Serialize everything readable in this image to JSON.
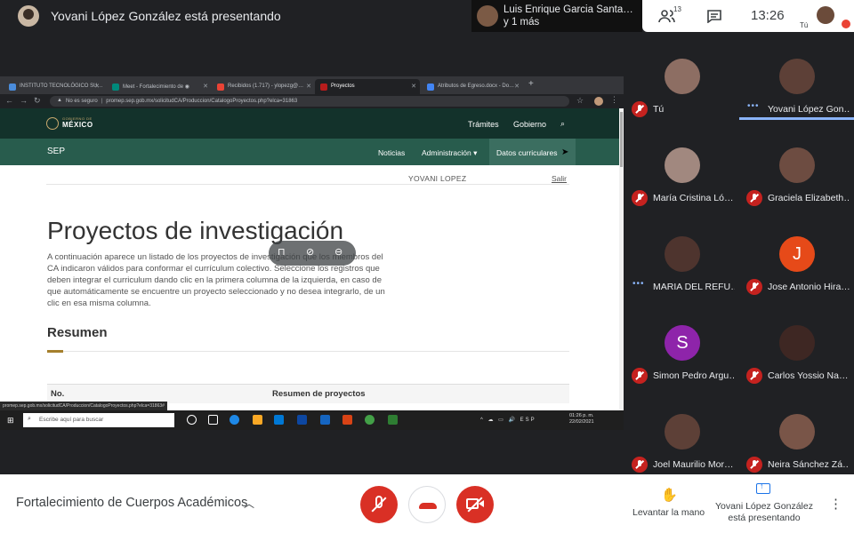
{
  "topbar": {
    "presenter_title": "Yovani López González está presentando",
    "speaker_name": "Luis Enrique Garcia Santa…",
    "speaker_more": "y 1 más",
    "people_count": "13",
    "clock": "13:26",
    "self_label": "Tú"
  },
  "browser": {
    "tabs": [
      {
        "label": "INSTITUTO TECNOLÓGICO SU…",
        "color": "#4a8cdb"
      },
      {
        "label": "Meet - Fortalecimiento de ◉",
        "color": "#00897b"
      },
      {
        "label": "Recibidos (1.717) - ylopezg@…",
        "color": "#ea4335"
      },
      {
        "label": "Proyectos",
        "color": "#b71c1c"
      },
      {
        "label": "Atributos de Egreso.docx - Do…",
        "color": "#4285f4"
      }
    ],
    "insecure": "No es seguro",
    "url": "promep.sep.gob.mx/solicitudCA/Produccion/CatalogoProyectos.php?elca=31863",
    "status_url": "promep.sep.gob.mx/solicitudCA/Produccion/CatalogoProyectos.php?elca=31863#"
  },
  "site": {
    "gov_small": "GOBIERNO DE",
    "gov_big": "MÉXICO",
    "tramites": "Trámites",
    "gobierno": "Gobierno",
    "sep": "SEP",
    "noticias": "Noticias",
    "administracion": "Administración ▾",
    "datos": "Datos curriculares",
    "user": "YOVANI LOPEZ",
    "logout": "Salir",
    "title": "Proyectos de investigación",
    "description": "A continuación aparece un listado de los proyectos de investigación que los miembros del CA indicaron válidos para conformar el currículum colectivo. Seleccione los registros que deben integrar el curriculum dando clic en la primera columna de la izquierda, en caso de que automáticamente se encuentre un proyecto seleccionado y no desea integrarlo, de un clic en esa misma columna.",
    "resumen": "Resumen",
    "col_no": "No.",
    "col_resumen": "Resumen de proyectos"
  },
  "taskbar": {
    "search_placeholder": "Escribe aquí para buscar",
    "tray": "^ ☁ ▭ 🔊 ESP",
    "time": "01:26 p. m.",
    "date": "22/02/2021"
  },
  "participants": [
    {
      "name": "Tú",
      "initial": "",
      "color": "#8d6e63",
      "muted": true
    },
    {
      "name": "Yovani López Gon…",
      "initial": "",
      "color": "#5d4037",
      "muted": false
    },
    {
      "name": "María Cristina Ló…",
      "initial": "",
      "color": "#a1887f",
      "muted": true
    },
    {
      "name": "Graciela Elizabeth…",
      "initial": "",
      "color": "#6d4c41",
      "muted": true
    },
    {
      "name": "MARIA DEL REFU…",
      "initial": "",
      "color": "#4e342e",
      "muted": false
    },
    {
      "name": "Jose Antonio Hira…",
      "initial": "J",
      "color": "#e64a19",
      "muted": true
    },
    {
      "name": "Simon Pedro Argu…",
      "initial": "S",
      "color": "#8e24aa",
      "muted": true
    },
    {
      "name": "Carlos Yossio Na…",
      "initial": "",
      "color": "#3e2723",
      "muted": true
    },
    {
      "name": "Joel Maurilio Mor…",
      "initial": "",
      "color": "#5d4037",
      "muted": true
    },
    {
      "name": "Neira Sánchez Zá…",
      "initial": "",
      "color": "#795548",
      "muted": true
    }
  ],
  "bottombar": {
    "meeting_title": "Fortalecimiento de Cuerpos Académicos",
    "raise_hand": "Levantar la mano",
    "presenting_line1": "Yovani López González",
    "presenting_line2": "está presentando"
  },
  "icons": {
    "people": "people-icon",
    "chat": "chat-icon",
    "mic_off": "mic-off-icon",
    "hangup": "phone-hangup-icon",
    "camera_off": "camera-off-icon",
    "hand": "hand-icon",
    "present": "present-screen-icon",
    "more": "more-vert-icon"
  },
  "colors": {
    "meet_bg": "#202124",
    "danger": "#d93025",
    "gov_dark": "#13322b",
    "gov_green": "#285c4d",
    "accent_blue": "#8ab4f8"
  }
}
